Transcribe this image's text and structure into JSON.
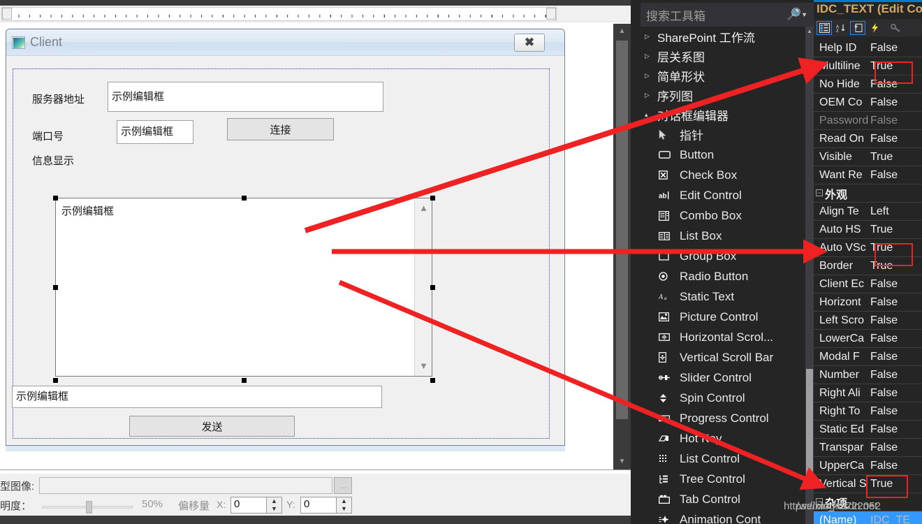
{
  "editor": {
    "dialog": {
      "title": "Client",
      "close_label": "✖",
      "fields": [
        {
          "name": "server-address",
          "label": "服务器地址",
          "value": "示例编辑框"
        },
        {
          "name": "port-number",
          "label": "端口号",
          "value": "示例编辑框"
        },
        {
          "name": "info-display",
          "label": "信息显示",
          "value": "示例编辑框"
        }
      ],
      "connect_button": "连接",
      "send_button": "发送",
      "send_input_value": "示例编辑框"
    }
  },
  "bottom_panel": {
    "image_label": "型图像:",
    "image_value": "",
    "browse_label": "...",
    "opacity_label": "明度：",
    "opacity_value": "50%",
    "offset_label": "偏移量",
    "offset_x_label": "X:",
    "offset_x_value": "0",
    "offset_y_label": "Y:",
    "offset_y_value": "0"
  },
  "toolbox": {
    "search_placeholder": "搜索工具箱",
    "search_icon": "search-icon",
    "dropdown_icon": "chevron-down-icon",
    "groups": [
      {
        "label": "SharePoint 工作流",
        "expanded": false
      },
      {
        "label": "层关系图",
        "expanded": false
      },
      {
        "label": "简单形状",
        "expanded": false
      },
      {
        "label": "序列图",
        "expanded": false
      },
      {
        "label": "对话框编辑器",
        "expanded": true
      }
    ],
    "items": [
      {
        "label": "指针",
        "icon": "pointer-icon"
      },
      {
        "label": "Button",
        "icon": "button-icon"
      },
      {
        "label": "Check Box",
        "icon": "checkbox-icon"
      },
      {
        "label": "Edit Control",
        "icon": "edit-control-icon"
      },
      {
        "label": "Combo Box",
        "icon": "combobox-icon"
      },
      {
        "label": "List Box",
        "icon": "listbox-icon"
      },
      {
        "label": "Group Box",
        "icon": "groupbox-icon"
      },
      {
        "label": "Radio Button",
        "icon": "radiobutton-icon"
      },
      {
        "label": "Static Text",
        "icon": "static-text-icon"
      },
      {
        "label": "Picture Control",
        "icon": "picture-control-icon"
      },
      {
        "label": "Horizontal Scrol...",
        "icon": "hscrollbar-icon"
      },
      {
        "label": "Vertical Scroll Bar",
        "icon": "vscrollbar-icon"
      },
      {
        "label": "Slider Control",
        "icon": "slider-icon"
      },
      {
        "label": "Spin Control",
        "icon": "spin-icon"
      },
      {
        "label": "Progress Control",
        "icon": "progress-icon"
      },
      {
        "label": "Hot Key",
        "icon": "hotkey-icon"
      },
      {
        "label": "List Control",
        "icon": "list-control-icon"
      },
      {
        "label": "Tree Control",
        "icon": "tree-control-icon"
      },
      {
        "label": "Tab Control",
        "icon": "tab-control-icon"
      },
      {
        "label": "Animation Cont",
        "icon": "animation-control-icon"
      }
    ]
  },
  "properties": {
    "header": "IDC_TEXT (Edit Co",
    "toolbar": [
      {
        "name": "categorized-button",
        "icon": "categorized-icon",
        "selected": true
      },
      {
        "name": "alphabetical-button",
        "icon": "sort-az-icon",
        "selected": false
      },
      {
        "name": "properties-button",
        "icon": "properties-page-icon",
        "selected": true
      },
      {
        "name": "events-button",
        "icon": "lightning-icon",
        "selected": false
      },
      {
        "name": "property-pages-button",
        "icon": "wrench-icon",
        "selected": false
      }
    ],
    "rows": [
      {
        "name": "Help ID",
        "value": "False",
        "kind": "prop"
      },
      {
        "name": "Multiline",
        "value": "True",
        "kind": "prop",
        "highlight": true
      },
      {
        "name": "No Hide",
        "value": "False",
        "kind": "prop"
      },
      {
        "name": "OEM Co",
        "value": "False",
        "kind": "prop"
      },
      {
        "name": "Password",
        "value": "False",
        "kind": "prop",
        "disabled": true
      },
      {
        "name": "Read On",
        "value": "False",
        "kind": "prop"
      },
      {
        "name": "Visible",
        "value": "True",
        "kind": "prop"
      },
      {
        "name": "Want Re",
        "value": "False",
        "kind": "prop"
      },
      {
        "name": "外观",
        "value": "",
        "kind": "category"
      },
      {
        "name": "Align Te",
        "value": "Left",
        "kind": "prop"
      },
      {
        "name": "Auto HS",
        "value": "True",
        "kind": "prop"
      },
      {
        "name": "Auto VSc",
        "value": "True",
        "kind": "prop",
        "highlight": true
      },
      {
        "name": "Border",
        "value": "True",
        "kind": "prop"
      },
      {
        "name": "Client Ec",
        "value": "False",
        "kind": "prop"
      },
      {
        "name": "Horizont",
        "value": "False",
        "kind": "prop"
      },
      {
        "name": "Left Scro",
        "value": "False",
        "kind": "prop"
      },
      {
        "name": "LowerCa",
        "value": "False",
        "kind": "prop"
      },
      {
        "name": "Modal F",
        "value": "False",
        "kind": "prop"
      },
      {
        "name": "Number",
        "value": "False",
        "kind": "prop"
      },
      {
        "name": "Right Ali",
        "value": "False",
        "kind": "prop"
      },
      {
        "name": "Right To",
        "value": "False",
        "kind": "prop"
      },
      {
        "name": "Static Ed",
        "value": "False",
        "kind": "prop"
      },
      {
        "name": "Transpar",
        "value": "False",
        "kind": "prop"
      },
      {
        "name": "UpperCa",
        "value": "False",
        "kind": "prop"
      },
      {
        "name": "Vertical S",
        "value": "True",
        "kind": "prop",
        "highlight": true
      },
      {
        "name": "杂项",
        "value": "",
        "kind": "category"
      },
      {
        "name": "(Name)",
        "value": "IDC_TE",
        "kind": "prop",
        "selected": true
      }
    ]
  },
  "annotations": {
    "arrow_color": "#ee2222",
    "highlight_color": "#ee2222",
    "watermark_top": "https://blog.csdn.net",
    "watermark_bottom": "/weixin_43722052"
  }
}
